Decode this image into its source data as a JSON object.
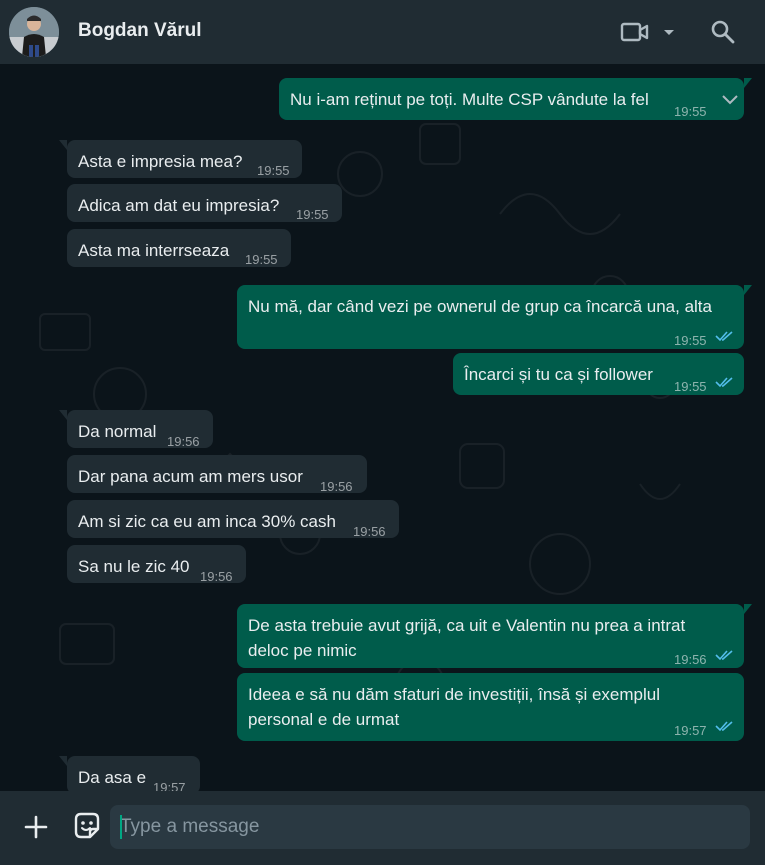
{
  "header": {
    "contact_name": "Bogdan Vărul",
    "icons": [
      "avatar",
      "video-call-icon",
      "chevron-down-icon",
      "search-icon"
    ]
  },
  "colors": {
    "background": "#0b141a",
    "header": "#202c33",
    "incoming_bubble": "#202c33",
    "outgoing_bubble": "#005c4b",
    "read_ticks": "#53bdeb"
  },
  "messages": [
    {
      "dir": "out",
      "text": "Nu i-am reținut pe toți. Multe CSP vândute la fel",
      "time": "19:55"
    },
    {
      "dir": "in",
      "text": "Asta e impresia mea?",
      "time": "19:55"
    },
    {
      "dir": "in",
      "text": "Adica am dat eu impresia?",
      "time": "19:55"
    },
    {
      "dir": "in",
      "text": "Asta ma interrseaza",
      "time": "19:55"
    },
    {
      "dir": "out",
      "text": "Nu mă, dar când vezi pe ownerul de grup ca încarcă una, alta",
      "time": "19:55",
      "read": true
    },
    {
      "dir": "out",
      "text": "Încarci și tu ca și follower",
      "time": "19:55",
      "read": true
    },
    {
      "dir": "in",
      "text": "Da normal",
      "time": "19:56"
    },
    {
      "dir": "in",
      "text": "Dar pana acum am mers usor",
      "time": "19:56"
    },
    {
      "dir": "in",
      "text": "Am si zic ca eu am inca 30% cash",
      "time": "19:56"
    },
    {
      "dir": "in",
      "text": "Sa nu le zic 40",
      "time": "19:56"
    },
    {
      "dir": "out",
      "text": "De asta trebuie avut grijă, ca uit e Valentin nu prea a intrat deloc pe nimic",
      "time": "19:56",
      "read": true
    },
    {
      "dir": "out",
      "text": "Ideea e să nu dăm sfaturi de investiții, însă și exemplul personal e de urmat",
      "time": "19:57",
      "read": true
    },
    {
      "dir": "in",
      "text": "Da asa e",
      "time": "19:57"
    }
  ],
  "composer": {
    "placeholder": "Type a message",
    "value": "",
    "icons": [
      "plus-icon",
      "sticker-icon"
    ]
  }
}
